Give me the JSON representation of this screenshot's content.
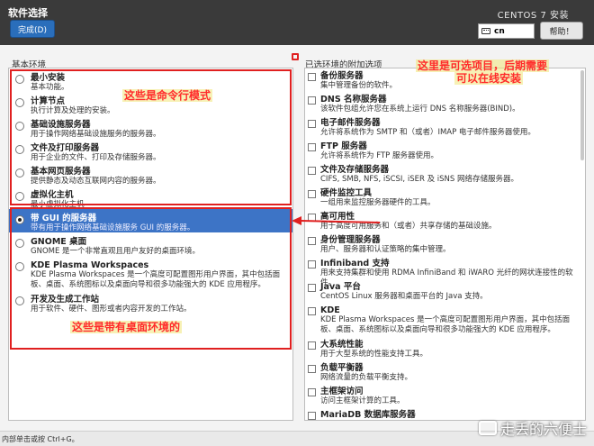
{
  "header": {
    "title": "软件选择",
    "done_label": "完成(D)",
    "install_title": "CENTOS 7 安装",
    "keyboard_layout": "cn",
    "help_label": "帮助！"
  },
  "left": {
    "label": "基本环境",
    "items": [
      {
        "name": "最小安装",
        "desc": "基本功能。",
        "selected": false
      },
      {
        "name": "计算节点",
        "desc": "执行计算及处理的安装。",
        "selected": false
      },
      {
        "name": "基础设施服务器",
        "desc": "用于操作网络基础设施服务的服务器。",
        "selected": false
      },
      {
        "name": "文件及打印服务器",
        "desc": "用于企业的文件、打印及存储服务器。",
        "selected": false
      },
      {
        "name": "基本网页服务器",
        "desc": "提供静态及动态互联网内容的服务器。",
        "selected": false
      },
      {
        "name": "虚拟化主机",
        "desc": "最小虚拟化主机",
        "selected": false
      },
      {
        "name": "带 GUI 的服务器",
        "desc": "带有用于操作网络基础设施服务 GUI 的服务器。",
        "selected": true
      },
      {
        "name": "GNOME 桌面",
        "desc": "GNOME 是一个非常直观且用户友好的桌面环境。",
        "selected": false
      },
      {
        "name": "KDE Plasma Workspaces",
        "desc": "KDE Plasma Workspaces 是一个高度可配置图形用户界面，其中包括面板、桌面、系统图标以及桌面向导和很多功能强大的 KDE 应用程序。",
        "selected": false
      },
      {
        "name": "开发及生成工作站",
        "desc": "用于软件、硬件、图形或者内容开发的工作站。",
        "selected": false
      }
    ]
  },
  "right": {
    "label": "已选环境的附加选项",
    "items": [
      {
        "name": "备份服务器",
        "desc": "集中管理备份的软件。"
      },
      {
        "name": "DNS 名称服务器",
        "desc": "该软件包组允许您在系统上运行 DNS 名称服务器(BIND)。"
      },
      {
        "name": "电子邮件服务器",
        "desc": "允许将系统作为 SMTP 和（或者）IMAP 电子邮件服务器使用。"
      },
      {
        "name": "FTP 服务器",
        "desc": "允许将系统作为 FTP 服务器使用。"
      },
      {
        "name": "文件及存储服务器",
        "desc": "CIFS, SMB, NFS, iSCSI, iSER 及 iSNS 网络存储服务器。"
      },
      {
        "name": "硬件监控工具",
        "desc": "一组用来监控服务器硬件的工具。"
      },
      {
        "name": "高可用性",
        "desc": "用于高度可用服务和（或者）共享存储的基础设施。"
      },
      {
        "name": "身份管理服务器",
        "desc": "用户、服务器和认证策略的集中管理。"
      },
      {
        "name": "Infiniband 支持",
        "desc": "用来支持集群和使用 RDMA InfiniBand 和 iWARO 光纤的网状连接性的软件。"
      },
      {
        "name": "Java 平台",
        "desc": "CentOS Linux 服务器和桌面平台的 Java 支持。"
      },
      {
        "name": "KDE",
        "desc": "KDE Plasma Workspaces 是一个高度可配置图形用户界面，其中包括面板、桌面、系统图标以及桌面向导和很多功能强大的 KDE 应用程序。"
      },
      {
        "name": "大系统性能",
        "desc": "用于大型系统的性能支持工具。"
      },
      {
        "name": "负载平衡器",
        "desc": "网络流量的负载平衡支持。"
      },
      {
        "name": "主框架访问",
        "desc": "访问主框架计算的工具。"
      },
      {
        "name": "MariaDB 数据库服务器",
        "desc": ""
      }
    ]
  },
  "annotations": {
    "cmdline": "这些是命令行模式",
    "desktop": "这些是带有桌面环境的",
    "optional_line1": "这里是可选项目，后期需要",
    "optional_line2": "可以在线安装"
  },
  "status": {
    "text": "内部单击或按 Ctrl+G。"
  },
  "watermark": {
    "text": "走丢的六便士"
  }
}
